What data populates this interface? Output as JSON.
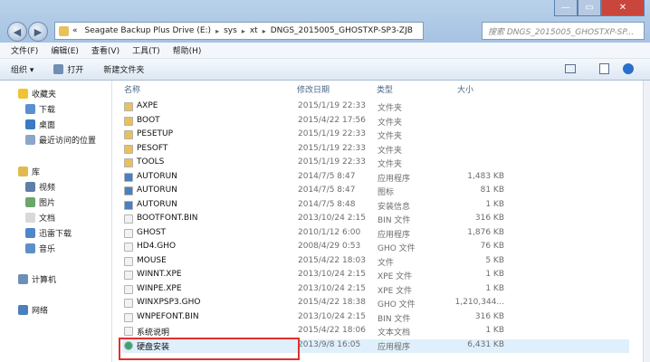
{
  "window": {
    "min_icon": "minimize-icon",
    "max_icon": "maximize-icon",
    "close_icon": "close-icon",
    "min_glyph": "—",
    "max_glyph": "▭",
    "close_glyph": "✕"
  },
  "address": {
    "chevron": "«",
    "segments": [
      "Seagate Backup Plus Drive (E:)",
      "sys",
      "xt",
      "DNGS_2015005_GHOSTXP-SP3-ZJB"
    ],
    "sep": "▸"
  },
  "search": {
    "placeholder": "搜索 DNGS_2015005_GHOSTXP-SP..."
  },
  "menu": [
    "文件(F)",
    "编辑(E)",
    "查看(V)",
    "工具(T)",
    "帮助(H)"
  ],
  "toolbar": {
    "organize": "组织 ▾",
    "open": "打开",
    "new_folder": "新建文件夹"
  },
  "nav": {
    "favorites": "收藏夹",
    "downloads": "下载",
    "desktop": "桌面",
    "recent": "最近访问的位置",
    "libraries": "库",
    "videos": "视频",
    "pictures": "图片",
    "documents": "文档",
    "thunder": "迅雷下载",
    "music": "音乐",
    "computer": "计算机",
    "network": "网络"
  },
  "columns": {
    "name": "名称",
    "date": "修改日期",
    "type": "类型",
    "size": "大小"
  },
  "files": [
    {
      "name": "AXPE",
      "date": "2015/1/19 22:33",
      "type": "文件夹",
      "size": "",
      "kind": "folder"
    },
    {
      "name": "BOOT",
      "date": "2015/4/22 17:56",
      "type": "文件夹",
      "size": "",
      "kind": "folder"
    },
    {
      "name": "PESETUP",
      "date": "2015/1/19 22:33",
      "type": "文件夹",
      "size": "",
      "kind": "folder"
    },
    {
      "name": "PESOFT",
      "date": "2015/1/19 22:33",
      "type": "文件夹",
      "size": "",
      "kind": "folder"
    },
    {
      "name": "TOOLS",
      "date": "2015/1/19 22:33",
      "type": "文件夹",
      "size": "",
      "kind": "folder"
    },
    {
      "name": "AUTORUN",
      "date": "2014/7/5 8:47",
      "type": "应用程序",
      "size": "1,483 KB",
      "kind": "app"
    },
    {
      "name": "AUTORUN",
      "date": "2014/7/5 8:47",
      "type": "图标",
      "size": "81 KB",
      "kind": "app"
    },
    {
      "name": "AUTORUN",
      "date": "2014/7/5 8:48",
      "type": "安装信息",
      "size": "1 KB",
      "kind": "app"
    },
    {
      "name": "BOOTFONT.BIN",
      "date": "2013/10/24 2:15",
      "type": "BIN 文件",
      "size": "316 KB",
      "kind": "file"
    },
    {
      "name": "GHOST",
      "date": "2010/1/12 6:00",
      "type": "应用程序",
      "size": "1,876 KB",
      "kind": "file"
    },
    {
      "name": "HD4.GHO",
      "date": "2008/4/29 0:53",
      "type": "GHO 文件",
      "size": "76 KB",
      "kind": "file"
    },
    {
      "name": "MOUSE",
      "date": "2015/4/22 18:03",
      "type": "文件",
      "size": "5 KB",
      "kind": "file"
    },
    {
      "name": "WINNT.XPE",
      "date": "2013/10/24 2:15",
      "type": "XPE 文件",
      "size": "1 KB",
      "kind": "file"
    },
    {
      "name": "WINPE.XPE",
      "date": "2013/10/24 2:15",
      "type": "XPE 文件",
      "size": "1 KB",
      "kind": "file"
    },
    {
      "name": "WINXPSP3.GHO",
      "date": "2015/4/22 18:38",
      "type": "GHO 文件",
      "size": "1,210,344...",
      "kind": "file"
    },
    {
      "name": "WNPEFONT.BIN",
      "date": "2013/10/24 2:15",
      "type": "BIN 文件",
      "size": "316 KB",
      "kind": "file"
    },
    {
      "name": "系统说明",
      "date": "2015/4/22 18:06",
      "type": "文本文档",
      "size": "1 KB",
      "kind": "file"
    },
    {
      "name": "硬盘安装",
      "date": "2013/9/8 16:05",
      "type": "应用程序",
      "size": "6,431 KB",
      "kind": "installer"
    }
  ],
  "colors": {
    "highlight": "#dff0fc",
    "box": "#e03030",
    "folder": "#e8c15a"
  }
}
